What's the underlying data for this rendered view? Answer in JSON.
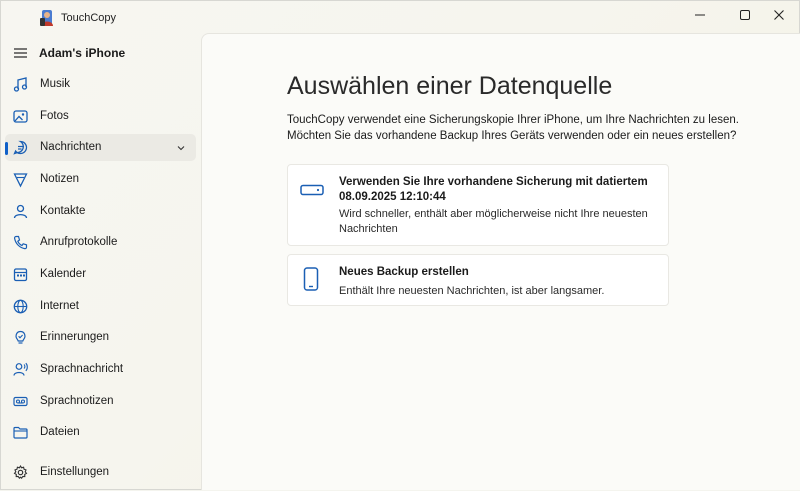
{
  "app": {
    "title": "TouchCopy"
  },
  "sidebar": {
    "device_name": "Adam's iPhone",
    "items": [
      {
        "label": "Musik",
        "icon": "music-icon"
      },
      {
        "label": "Fotos",
        "icon": "photos-icon"
      },
      {
        "label": "Nachrichten",
        "icon": "messages-icon",
        "active": true,
        "expandable": true
      },
      {
        "label": "Notizen",
        "icon": "notes-icon"
      },
      {
        "label": "Kontakte",
        "icon": "contacts-icon"
      },
      {
        "label": "Anrufprotokolle",
        "icon": "phone-icon"
      },
      {
        "label": "Kalender",
        "icon": "calendar-icon"
      },
      {
        "label": "Internet",
        "icon": "globe-icon"
      },
      {
        "label": "Erinnerungen",
        "icon": "reminders-icon"
      },
      {
        "label": "Sprachnachricht",
        "icon": "voicemail-icon"
      },
      {
        "label": "Sprachnotizen",
        "icon": "voice-memo-icon"
      },
      {
        "label": "Dateien",
        "icon": "folder-icon"
      }
    ],
    "settings_label": "Einstellungen"
  },
  "main": {
    "heading": "Auswählen einer Datenquelle",
    "description": "TouchCopy verwendet eine Sicherungskopie Ihrer iPhone, um Ihre Nachrichten zu lesen. Möchten Sie das vorhandene Backup Ihres Geräts verwenden oder ein neues erstellen?",
    "options": [
      {
        "title": "Verwenden Sie Ihre vorhandene Sicherung mit datiertem 08.09.2025 12:10:44",
        "subtitle": "Wird schneller, enthält aber möglicherweise nicht Ihre neuesten Nachrichten",
        "icon": "hard-drive-icon"
      },
      {
        "title": "Neues Backup erstellen",
        "subtitle": "Enthält Ihre neuesten Nachrichten, ist aber langsamer.",
        "icon": "smartphone-icon"
      }
    ]
  },
  "colors": {
    "accent": "#1060c8",
    "icon": "#1a5fb4",
    "sidebar_bg": "#f6f5ee",
    "content_bg": "#fbfbf8"
  }
}
